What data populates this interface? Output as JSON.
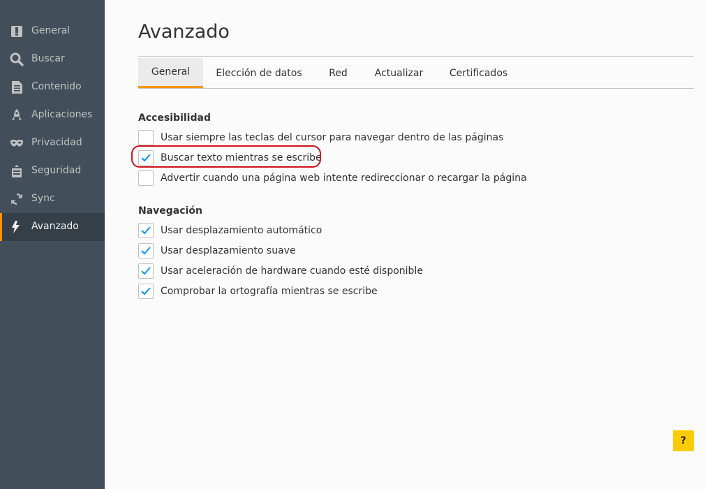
{
  "sidebar": {
    "items": [
      {
        "label": "General",
        "icon": "general-icon"
      },
      {
        "label": "Buscar",
        "icon": "search-icon"
      },
      {
        "label": "Contenido",
        "icon": "content-icon"
      },
      {
        "label": "Aplicaciones",
        "icon": "applications-icon"
      },
      {
        "label": "Privacidad",
        "icon": "privacy-mask-icon"
      },
      {
        "label": "Seguridad",
        "icon": "security-icon"
      },
      {
        "label": "Sync",
        "icon": "sync-icon"
      },
      {
        "label": "Avanzado",
        "icon": "advanced-icon"
      }
    ],
    "active": "Avanzado",
    "accent": "#ff9500"
  },
  "main": {
    "title": "Avanzado",
    "tabs": [
      {
        "label": "General",
        "active": true
      },
      {
        "label": "Elección de datos",
        "active": false
      },
      {
        "label": "Red",
        "active": false
      },
      {
        "label": "Actualizar",
        "active": false
      },
      {
        "label": "Certificados",
        "active": false
      }
    ],
    "sections": [
      {
        "title": "Accesibilidad",
        "options": [
          {
            "label": "Usar siempre las teclas del cursor para navegar dentro de las páginas",
            "checked": false
          },
          {
            "label": "Buscar texto mientras se escribe",
            "checked": true,
            "highlighted": true
          },
          {
            "label": "Advertir cuando una página web intente redireccionar o recargar la página",
            "checked": false
          }
        ]
      },
      {
        "title": "Navegación",
        "options": [
          {
            "label": "Usar desplazamiento automático",
            "checked": true
          },
          {
            "label": "Usar desplazamiento suave",
            "checked": true
          },
          {
            "label": "Usar aceleración de hardware cuando esté disponible",
            "checked": true
          },
          {
            "label": "Comprobar la ortografía mientras se escribe",
            "checked": true
          }
        ]
      }
    ],
    "help_label": "?",
    "highlight_color": "#d0121b"
  }
}
